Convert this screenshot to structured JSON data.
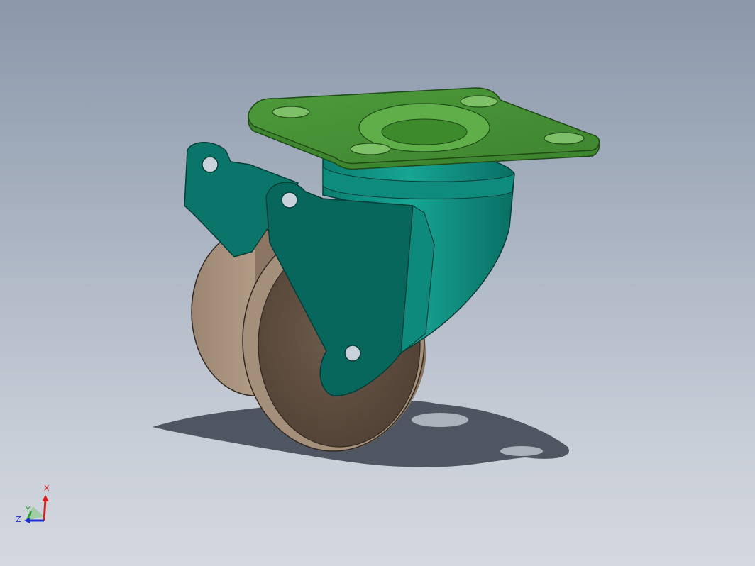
{
  "viewport": {
    "background_top": "#8a98aa",
    "background_bottom": "#d4d8df"
  },
  "model": {
    "parts": [
      "mounting-plate",
      "swivel-housing",
      "fork-yoke",
      "wheel"
    ],
    "colors": {
      "plate": "#4f9a3c",
      "plate_top": "#5fae49",
      "plate_edge": "#3e7e2e",
      "fork": "#0a7a6e",
      "fork_dark": "#066158",
      "fork_light": "#1aa596",
      "wheel": "#7d6a58",
      "wheel_light": "#a58f7a",
      "wheel_dark": "#5c4b3d",
      "shadow": "#3d4450"
    }
  },
  "triad": {
    "x_label": "X",
    "y_label": "Y",
    "z_label": "Z",
    "x_color": "#d42020",
    "y_color": "#2aa02a",
    "z_color": "#2030d0"
  }
}
